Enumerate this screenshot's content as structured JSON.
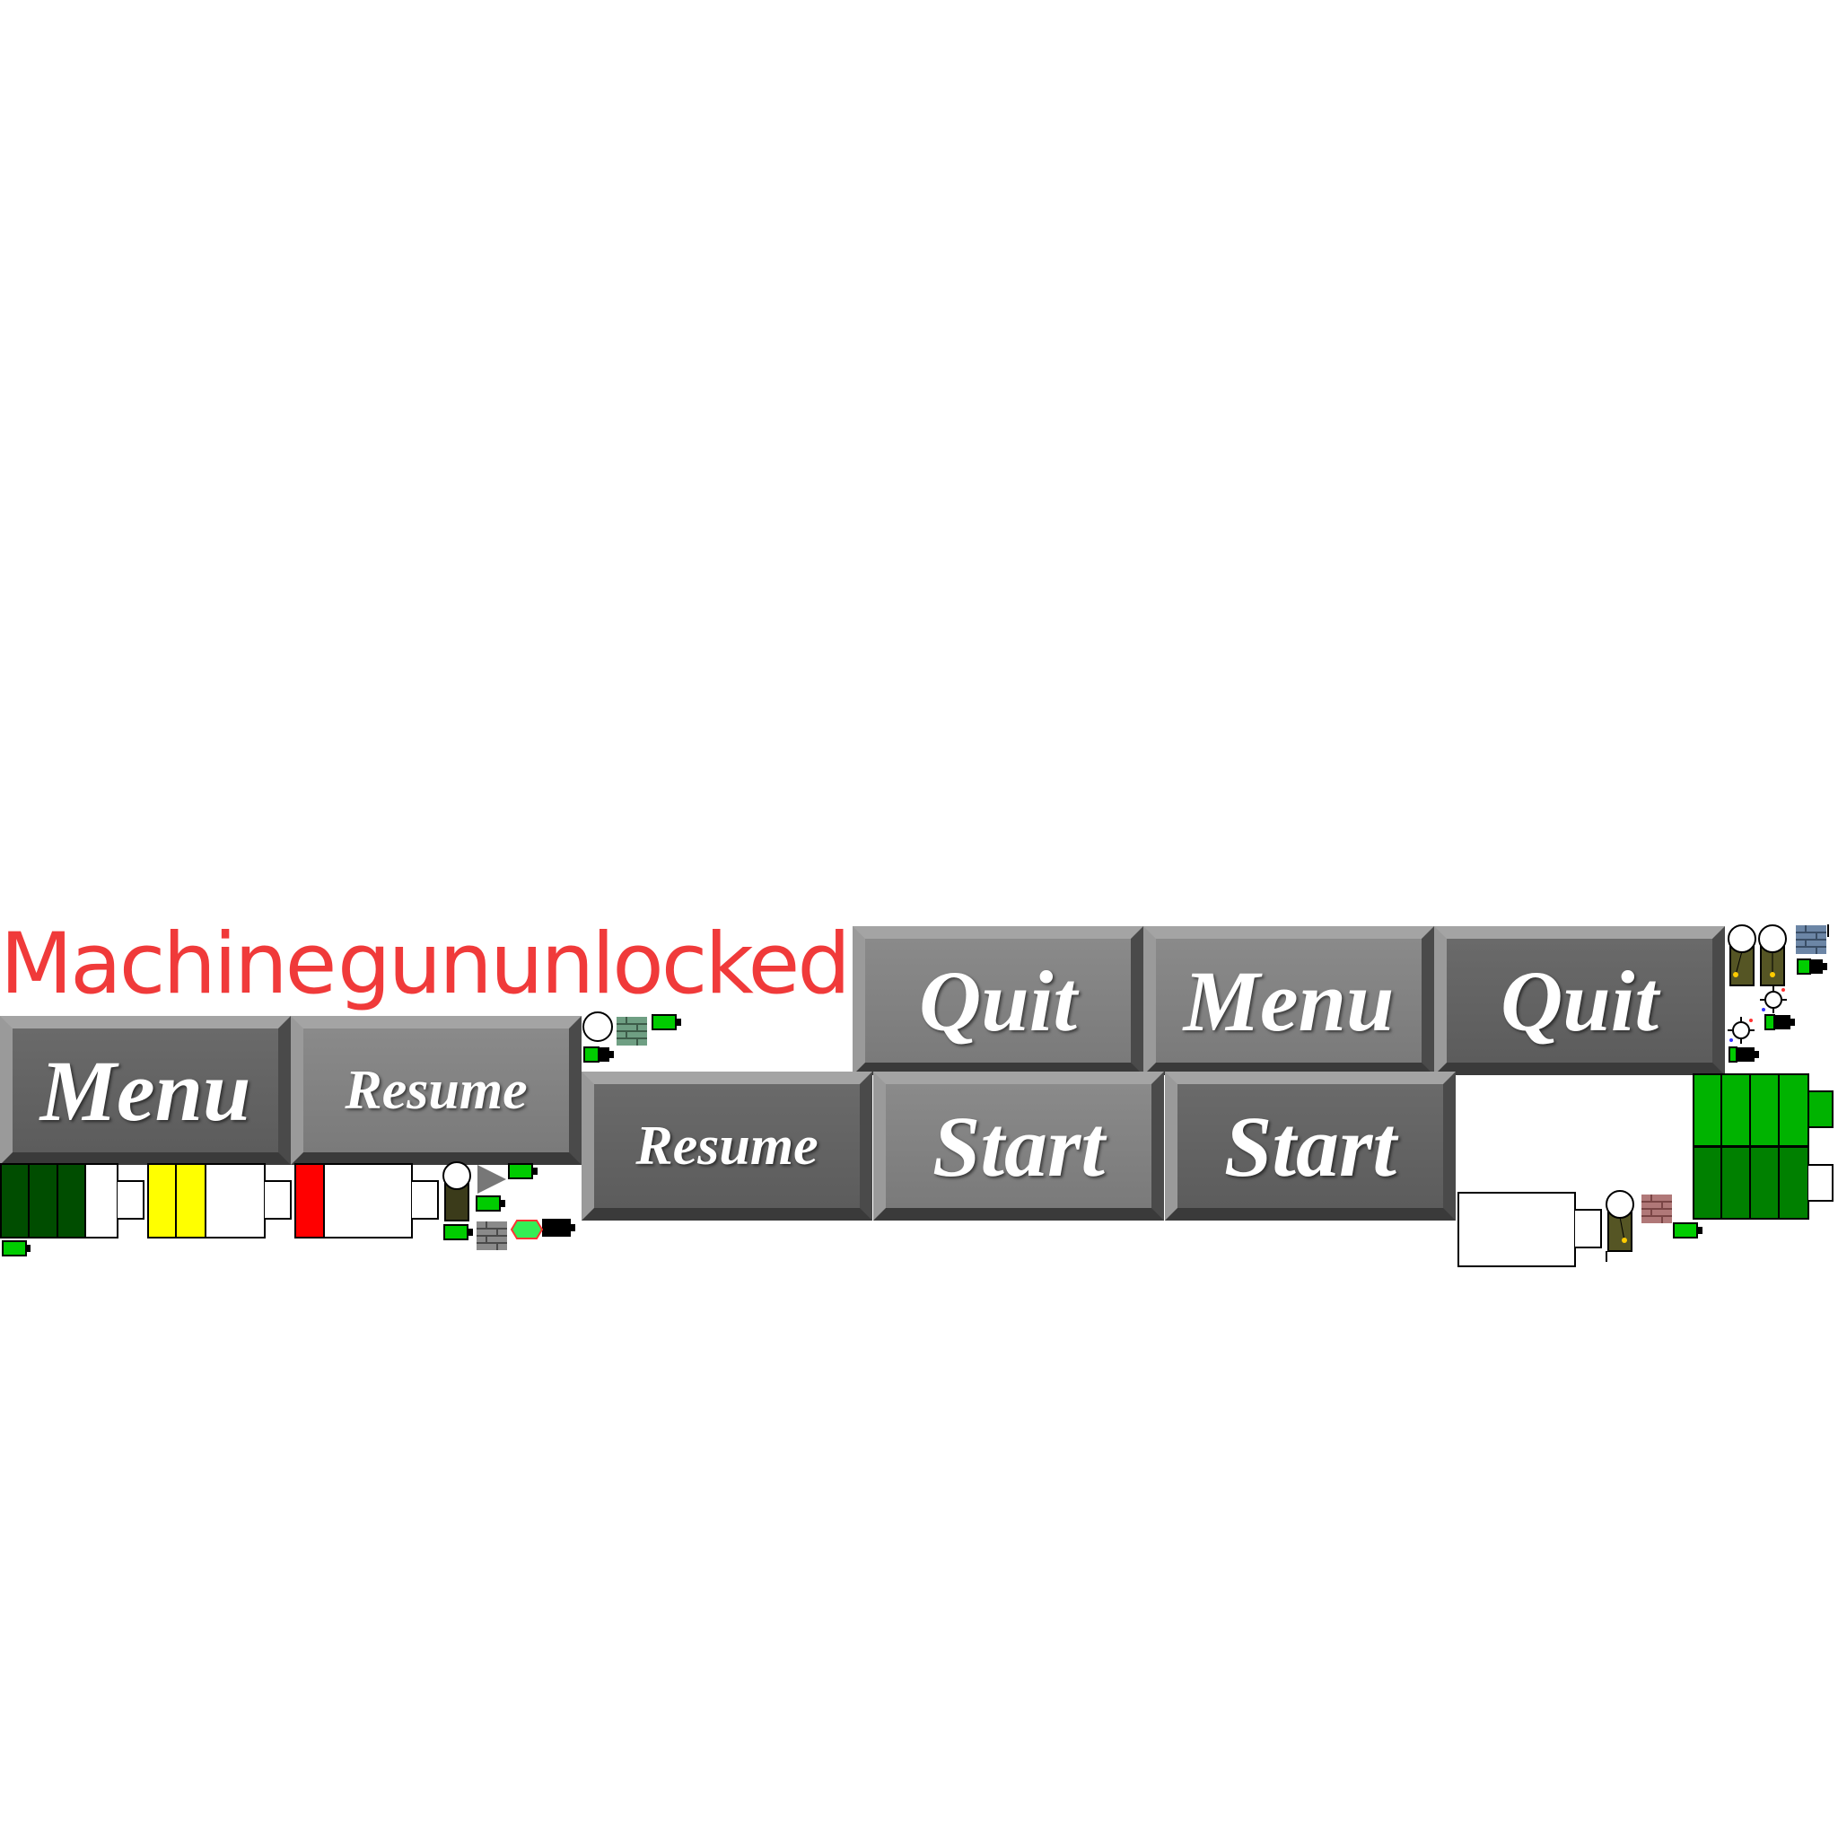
{
  "notification": {
    "word1": "Machine",
    "word2": "gun",
    "word3": "unlocked!",
    "color": "#f03a3a"
  },
  "buttons": {
    "quit_1": "Quit",
    "menu_1": "Menu",
    "quit_2": "Quit",
    "menu_2": "Menu",
    "resume_1": "Resume",
    "resume_2": "Resume",
    "start_1": "Start",
    "start_2": "Start"
  },
  "colors": {
    "button_light": "#808080",
    "button_dark": "#636363",
    "health_green": "#004d00",
    "health_yellow": "#ffff00",
    "health_red": "#ff0000",
    "battery_green": "#00cc00",
    "bright_green": "#00b300"
  },
  "sprites": [
    "battery-icon",
    "soldier-icon",
    "brick-block-icon",
    "gem-icon",
    "arrow-icon",
    "mine-icon"
  ]
}
